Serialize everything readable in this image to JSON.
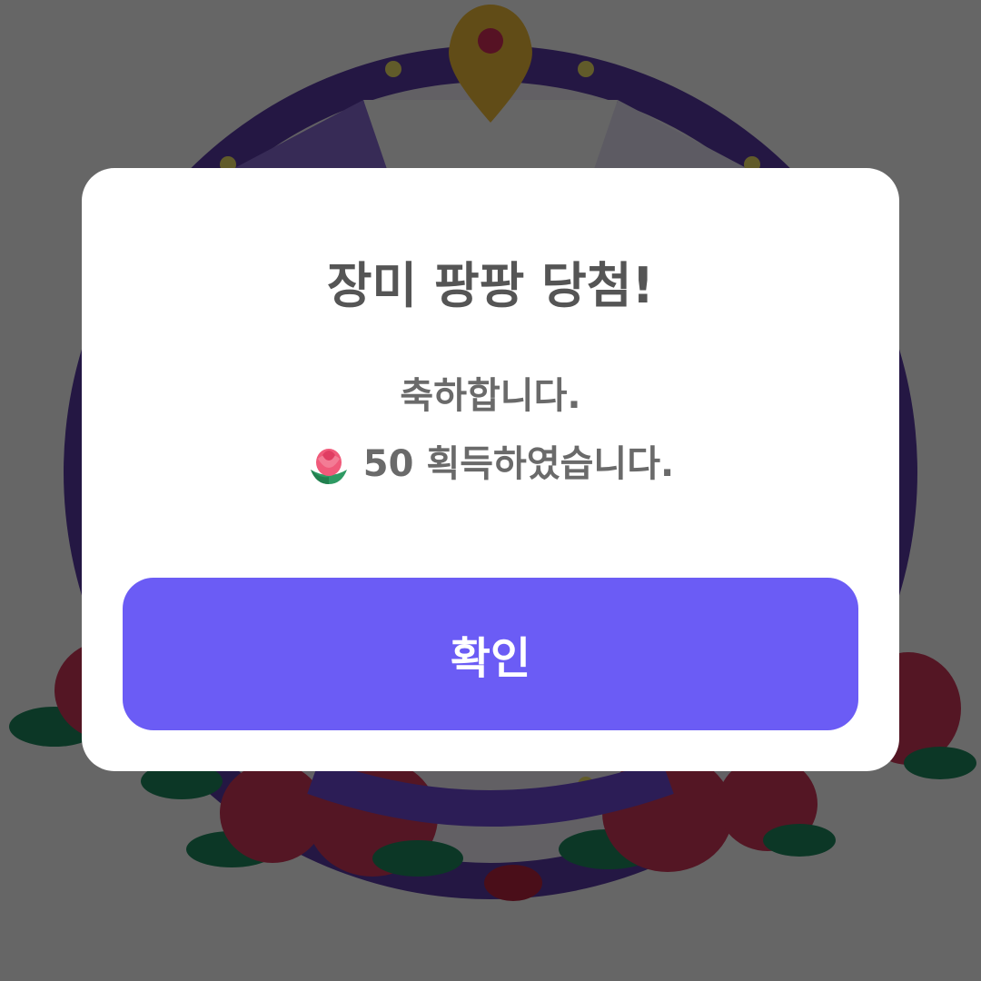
{
  "modal": {
    "title": "장미 팡팡 당첨!",
    "message_line1": "축하합니다.",
    "reward_amount": "50",
    "reward_suffix": "획득하였습니다.",
    "reward_icon": "rose-icon",
    "confirm_label": "확인"
  },
  "colors": {
    "overlay": "#666666",
    "button": "#6b5cf5",
    "wheel_rim": "#4c2f8c",
    "pointer": "#b8912c",
    "rose": "#c4304b",
    "leaf": "#1f7a55"
  }
}
